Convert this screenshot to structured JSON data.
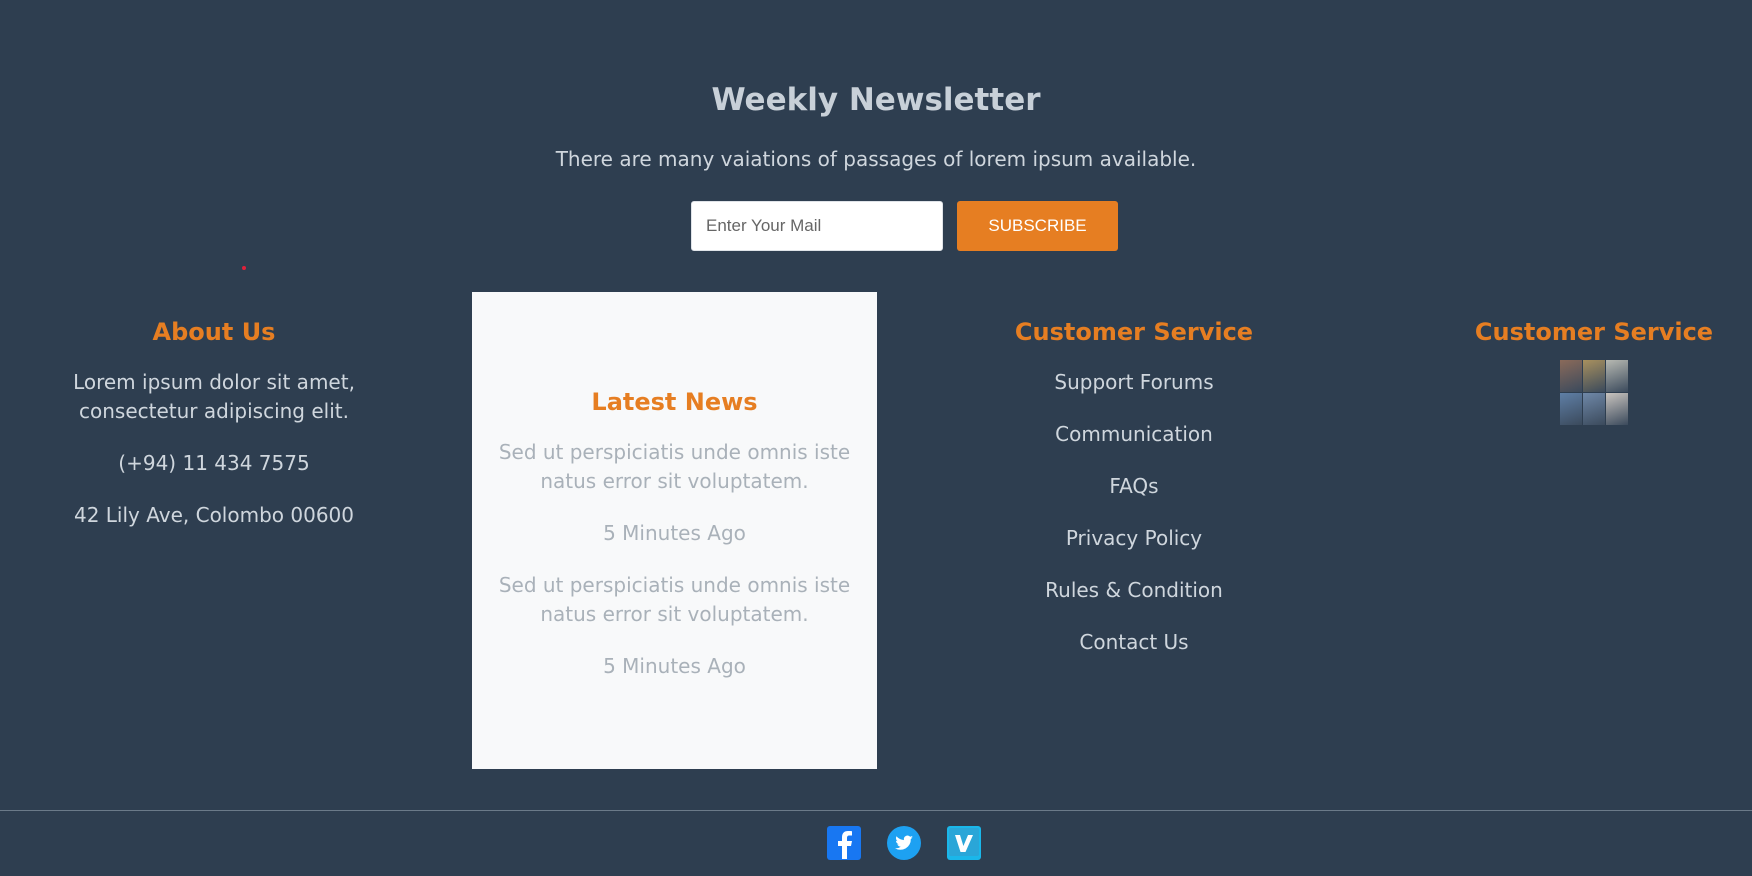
{
  "newsletter": {
    "title": "Weekly Newsletter",
    "subtitle": "There are many vaiations of passages of lorem ipsum available.",
    "email_placeholder": "Enter Your Mail",
    "subscribe_label": "SUBSCRIBE"
  },
  "about": {
    "title": "About Us",
    "description": "Lorem ipsum dolor sit amet, consectetur adipiscing elit.",
    "phone": "(+94) 11 434 7575",
    "address": "42 Lily Ave, Colombo 00600"
  },
  "news": {
    "title": "Latest News",
    "items": [
      {
        "text": "Sed ut perspiciatis unde omnis iste natus error sit voluptatem.",
        "time": "5 Minutes Ago"
      },
      {
        "text": "Sed ut perspiciatis unde omnis iste natus error sit voluptatem.",
        "time": "5 Minutes Ago"
      }
    ]
  },
  "service": {
    "title": "Customer Service",
    "links": [
      "Support Forums",
      "Communication",
      "FAQs",
      "Privacy Policy",
      "Rules & Condition",
      "Contact Us"
    ]
  },
  "gallery": {
    "title": "Customer Service",
    "thumbnails": [
      "#8a6a5a",
      "#a8905e",
      "#b7b9b2",
      "#5f7fa6",
      "#6f88a8",
      "#c9c4bf"
    ]
  },
  "social": {
    "icons": [
      "facebook-icon",
      "twitter-icon",
      "vimeo-icon"
    ]
  },
  "colors": {
    "background": "#2e3e50",
    "accent": "#e67e22",
    "panel": "#f8f9fa"
  }
}
